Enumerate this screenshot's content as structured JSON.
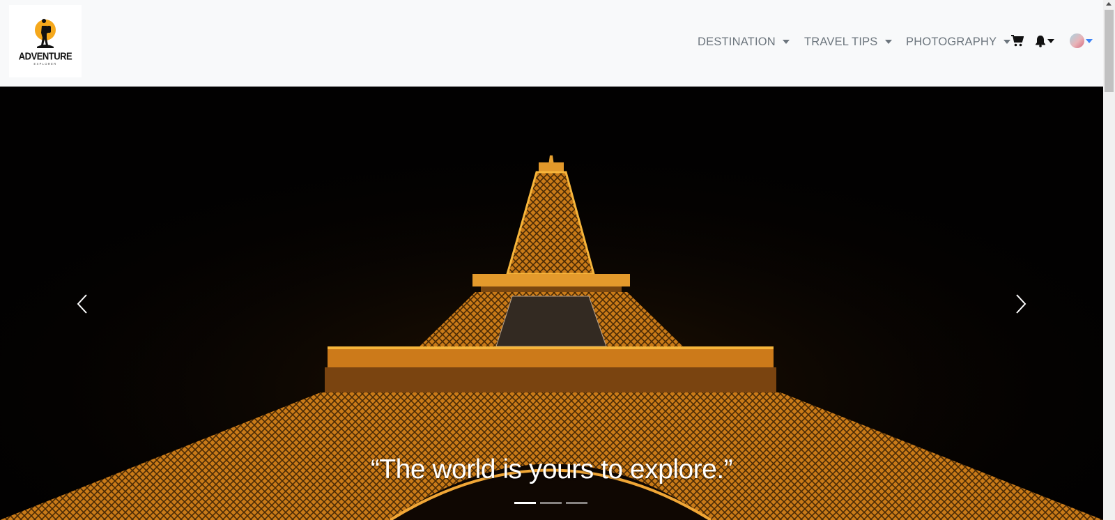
{
  "brand": {
    "name": "ADVENTURE",
    "tagline": "EXPLORER"
  },
  "nav": {
    "items": [
      {
        "label": "DESTINATION"
      },
      {
        "label": "TRAVEL TIPS"
      },
      {
        "label": "PHOTOGRAPHY"
      }
    ],
    "icons": [
      "cart-icon",
      "bell-icon",
      "avatar"
    ]
  },
  "hero": {
    "caption": "“The world is yours to explore.”",
    "slide_count": 3,
    "active_slide": 1
  },
  "colors": {
    "navbar_bg": "#f8f9fa",
    "nav_text": "#6c757d",
    "logo_sun": "#f5a81c",
    "tower_light": "#e8a020",
    "user_caret": "#3b82f6"
  }
}
